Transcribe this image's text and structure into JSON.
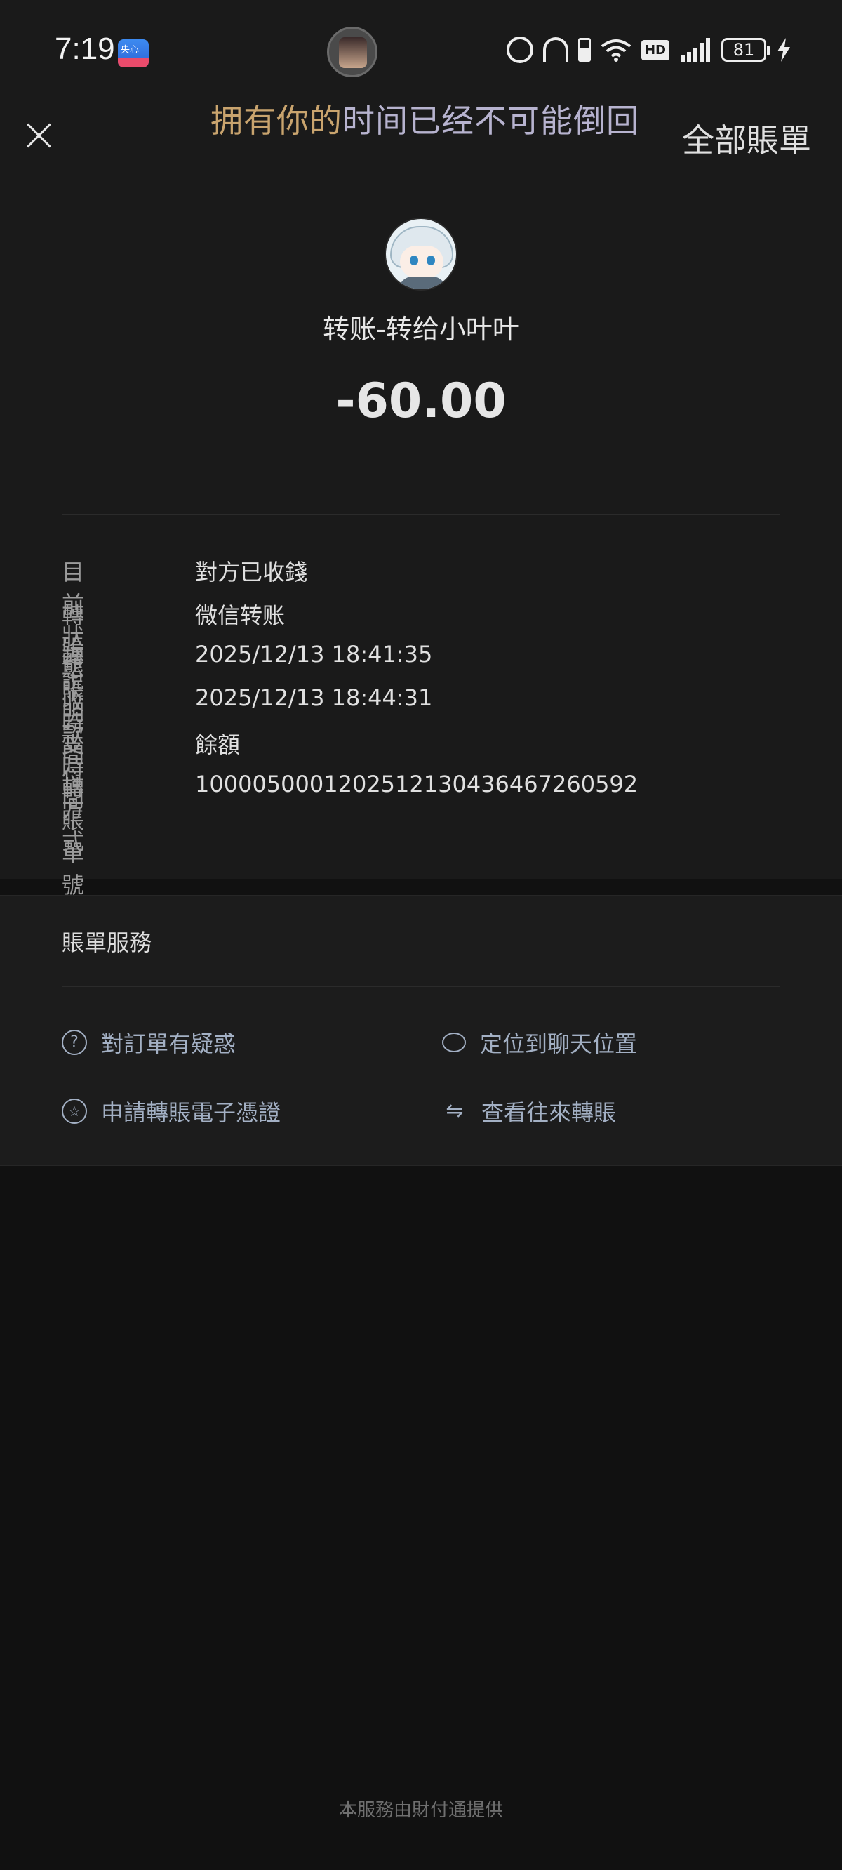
{
  "status_bar": {
    "time": "7:19",
    "app_badge_text": "央心",
    "battery": "81",
    "network_badge": "HD"
  },
  "header": {
    "close_icon": "close-icon",
    "banner_part1": "拥有你的",
    "banner_part2": "时间已经不可能倒回",
    "all_bills": "全部賬單"
  },
  "transfer": {
    "title": "转账-转给小叶叶",
    "amount": "-60.00"
  },
  "details": [
    {
      "label": "目前狀態",
      "value": "對方已收錢"
    },
    {
      "label": "轉賬說明",
      "value": "微信转账"
    },
    {
      "label": "轉賬時間",
      "value": "2025/12/13 18:41:35"
    },
    {
      "label": "收款時間",
      "value": "2025/12/13 18:44:31"
    },
    {
      "label": "支付方式",
      "value": "餘額"
    },
    {
      "label": "轉賬單號",
      "value": "1000050001202512130436467260592"
    }
  ],
  "services": {
    "title": "賬單服務",
    "items": [
      {
        "label": "對訂單有疑惑",
        "icon": "question-icon"
      },
      {
        "label": "定位到聊天位置",
        "icon": "chat-bubble-icon"
      },
      {
        "label": "申請轉賬電子憑證",
        "icon": "star-badge-icon"
      },
      {
        "label": "查看往來轉賬",
        "icon": "swap-arrows-icon"
      }
    ]
  },
  "footer": "本服務由財付通提供",
  "colors": {
    "background": "#111111",
    "panel": "#1a1a1a",
    "banner_gold": "#c9a46e",
    "banner_lavender": "#b7b3cf",
    "service_link": "#a3b0c4"
  }
}
